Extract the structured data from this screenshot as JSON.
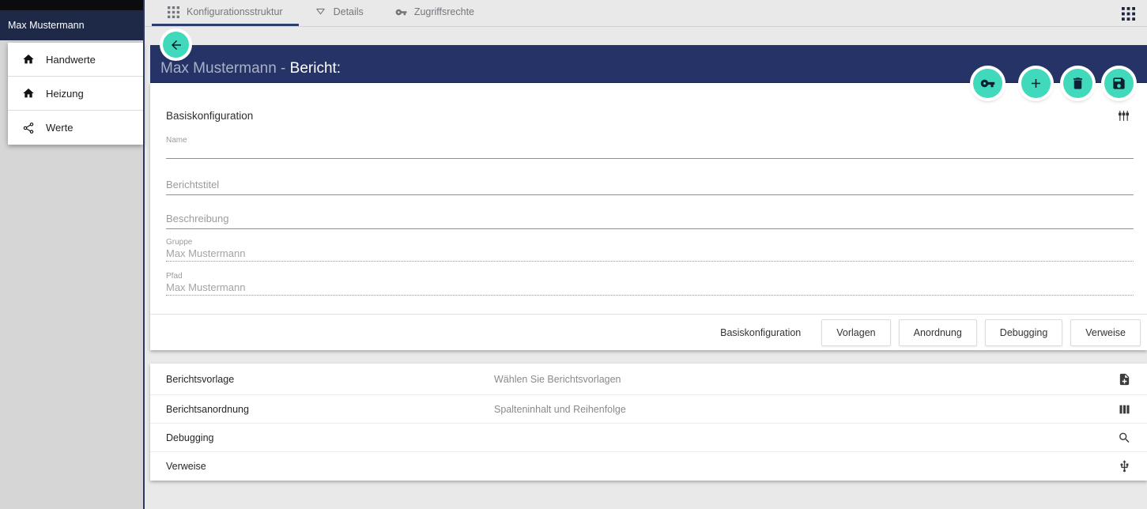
{
  "sidebar": {
    "title": "Max Mustermann",
    "items": [
      {
        "label": "Handwerte",
        "icon": "home-icon"
      },
      {
        "label": "Heizung",
        "icon": "home-icon"
      },
      {
        "label": "Werte",
        "icon": "share-icon"
      }
    ]
  },
  "tabs": [
    {
      "label": "Konfigurationsstruktur",
      "icon": "grid-icon",
      "active": true
    },
    {
      "label": "Details",
      "icon": "filter-icon",
      "active": false
    },
    {
      "label": "Zugriffsrechte",
      "icon": "key-icon",
      "active": false
    }
  ],
  "header": {
    "title_prefix": "Max Mustermann - ",
    "title_emphasis": "Bericht:",
    "actions": [
      {
        "name": "key-button",
        "icon": "key-icon"
      },
      {
        "name": "add-button",
        "icon": "plus-icon"
      },
      {
        "name": "delete-button",
        "icon": "trash-icon"
      },
      {
        "name": "save-button",
        "icon": "save-icon"
      }
    ]
  },
  "form": {
    "section_title": "Basiskonfiguration",
    "fields": [
      {
        "label": "Name",
        "value": "",
        "state": "active-empty"
      },
      {
        "label": "Berichtstitel",
        "value": "",
        "state": "placeholder"
      },
      {
        "label": "Beschreibung",
        "value": "",
        "state": "placeholder"
      },
      {
        "label": "Gruppe",
        "value": "Max Mustermann",
        "state": "disabled"
      },
      {
        "label": "Pfad",
        "value": "Max Mustermann",
        "state": "disabled"
      }
    ],
    "footer_buttons": [
      {
        "label": "Basiskonfiguration",
        "style": "flat"
      },
      {
        "label": "Vorlagen",
        "style": "outlined"
      },
      {
        "label": "Anordnung",
        "style": "outlined"
      },
      {
        "label": "Debugging",
        "style": "outlined"
      },
      {
        "label": "Verweise",
        "style": "outlined"
      }
    ]
  },
  "list": {
    "rows": [
      {
        "label": "Berichtsvorlage",
        "description": "Wählen Sie Berichtsvorlagen",
        "icon": "note-add-icon"
      },
      {
        "label": "Berichtsanordnung",
        "description": "Spalteninhalt und Reihenfolge",
        "icon": "view-column-icon"
      },
      {
        "label": "Debugging",
        "description": "",
        "icon": "search-icon"
      },
      {
        "label": "Verweise",
        "description": "",
        "icon": "usb-icon"
      }
    ]
  },
  "colors": {
    "accent_teal": "#40d9bc",
    "header_navy": "#263367",
    "sidebar_navy": "#1d2947",
    "top_strip": "#0b0b10",
    "active_tab_underline": "#2c3e70",
    "background": "#e9e9e9"
  }
}
